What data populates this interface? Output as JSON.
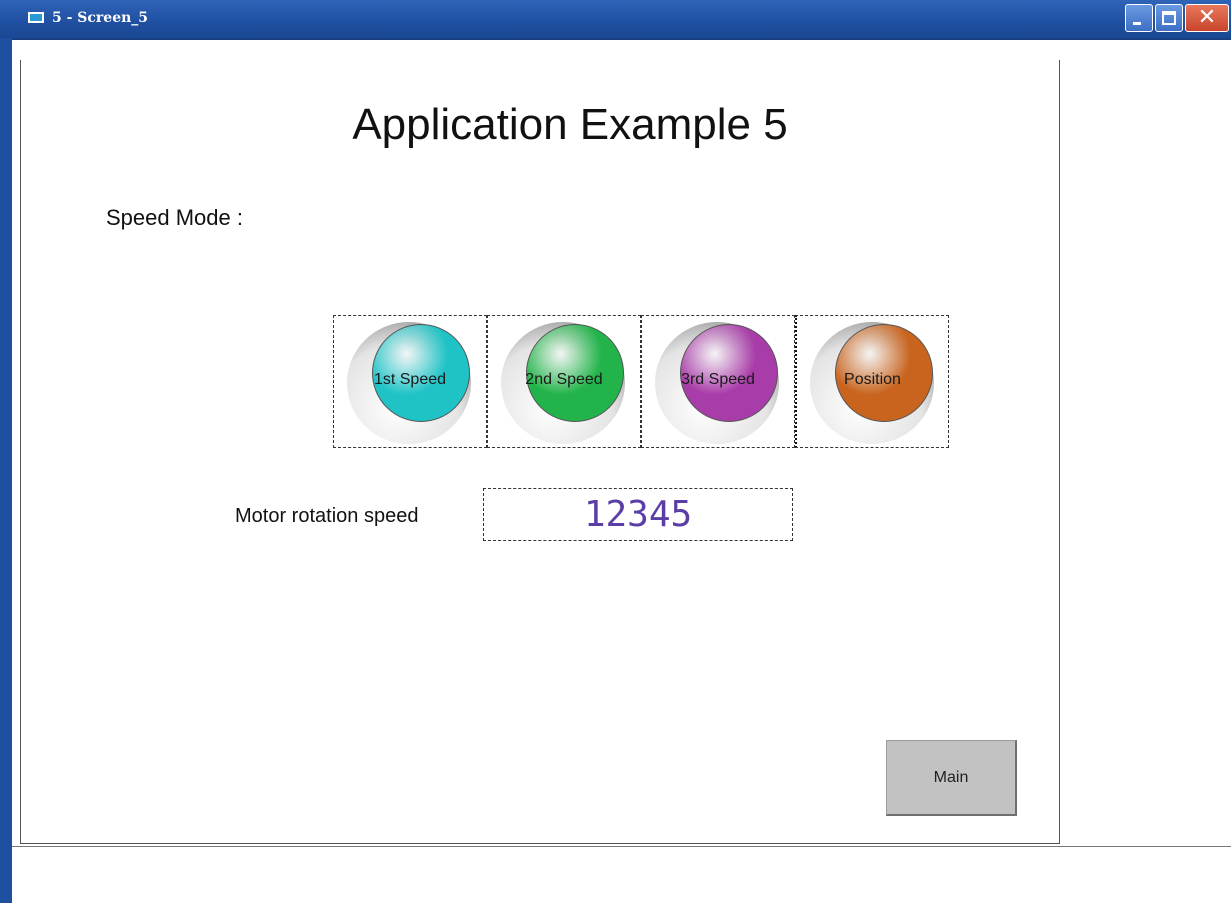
{
  "window": {
    "title": "5 - Screen_5",
    "close_glyph": "✕"
  },
  "screen": {
    "title": "Application Example 5",
    "speed_mode_label": "Speed Mode :",
    "buttons": [
      {
        "label": "1st Speed",
        "color": "#1fc3c6"
      },
      {
        "label": "2nd Speed",
        "color": "#22b44a"
      },
      {
        "label": "3rd Speed",
        "color": "#a83ca8"
      },
      {
        "label": "Position",
        "color": "#c8641e"
      }
    ],
    "motor_label": "Motor rotation speed",
    "motor_value": "12345",
    "value_color": "#5a3ea6",
    "main_button_label": "Main"
  },
  "icons": [
    "window-app-icon",
    "minimize-icon",
    "maximize-icon",
    "close-icon"
  ]
}
